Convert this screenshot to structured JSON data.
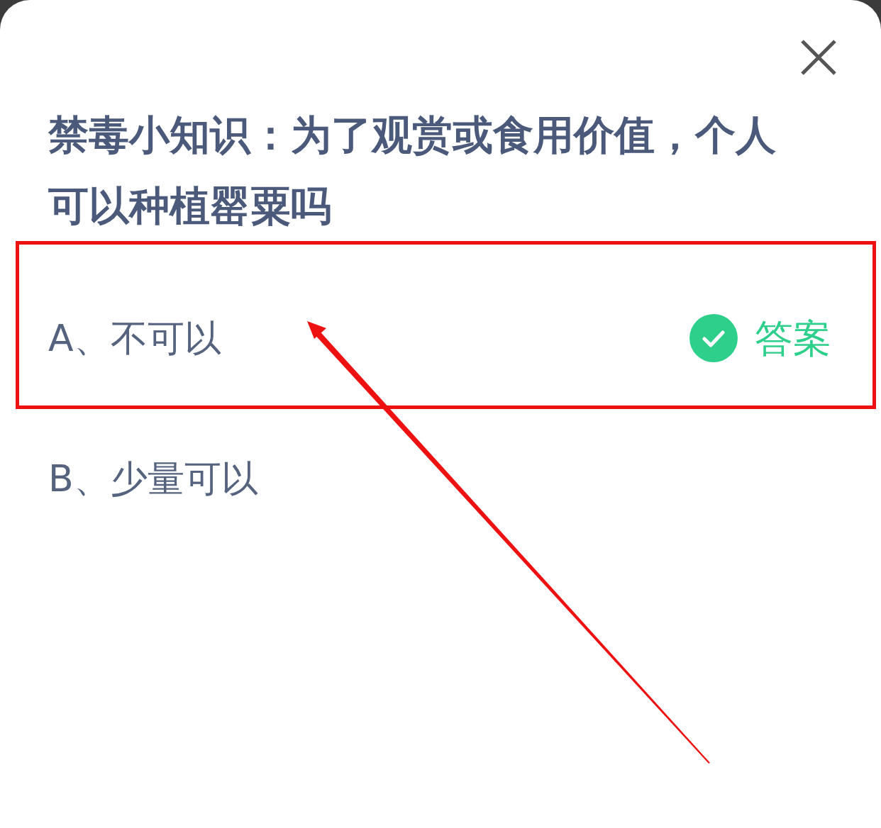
{
  "question": "禁毒小知识：为了观赏或食用价值，个人可以种植罂粟吗",
  "options": [
    {
      "label": "A、不可以",
      "correct": true,
      "answer_label": "答案",
      "highlighted": true
    },
    {
      "label": "B、少量可以",
      "correct": false,
      "highlighted": false
    }
  ]
}
